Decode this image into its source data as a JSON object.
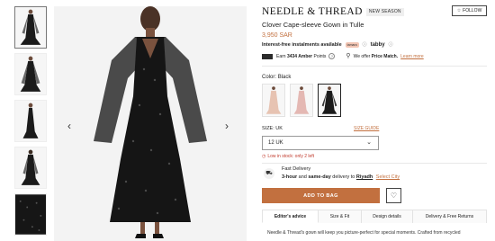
{
  "gallery": {
    "thumbnails": [
      {
        "alt": "front view",
        "selected": true
      },
      {
        "alt": "front view full",
        "selected": false
      },
      {
        "alt": "side view",
        "selected": false
      },
      {
        "alt": "back view",
        "selected": false
      },
      {
        "alt": "fabric detail",
        "selected": false
      }
    ],
    "prev_icon": "chevron-left-icon",
    "next_icon": "chevron-right-icon"
  },
  "product": {
    "brand": "NEEDLE & THREAD",
    "badge": "NEW SEASON",
    "follow_label": "FOLLOW",
    "title": "Clover Cape-sleeve Gown in Tulle",
    "price": "3,950 SAR"
  },
  "installments": {
    "label": "Interest-free instalments available",
    "provider_1": "tamara",
    "provider_2": "tabby"
  },
  "rewards": {
    "earn_prefix": "Earn",
    "points": "3434 Amber",
    "points_suffix": "Points",
    "price_match": "We offer",
    "price_match_bold": "Price Match.",
    "learn_more": "Learn more"
  },
  "colors": {
    "label": "Color:",
    "selected": "Black",
    "swatches": [
      {
        "name": "Blush",
        "selected": false
      },
      {
        "name": "Pink",
        "selected": false
      },
      {
        "name": "Black",
        "selected": true
      }
    ]
  },
  "size": {
    "label": "SIZE:",
    "system": "UK",
    "guide_label": "SIZE GUIDE",
    "selected": "12 UK",
    "stock_note": "Low in stock: only 2 left"
  },
  "delivery": {
    "title": "Fast Delivery",
    "speed_1": "3-hour",
    "and": "and",
    "speed_2": "same-day",
    "to": "delivery to",
    "city": "Riyadh",
    "select_city": "Select City"
  },
  "actions": {
    "add_to_bag": "ADD TO BAG",
    "wishlist_icon": "heart-icon"
  },
  "tabs": [
    {
      "label": "Editor's advice",
      "active": true
    },
    {
      "label": "Size & Fit",
      "active": false
    },
    {
      "label": "Design details",
      "active": false
    },
    {
      "label": "Delivery & Free Returns",
      "active": false
    }
  ],
  "description": "Needle & Thread's gown will keep you picture-perfect for special moments. Crafted from recycled",
  "colors_hex": {
    "accent": "#c2703f",
    "text": "#222222",
    "stock": "#c0392b"
  }
}
